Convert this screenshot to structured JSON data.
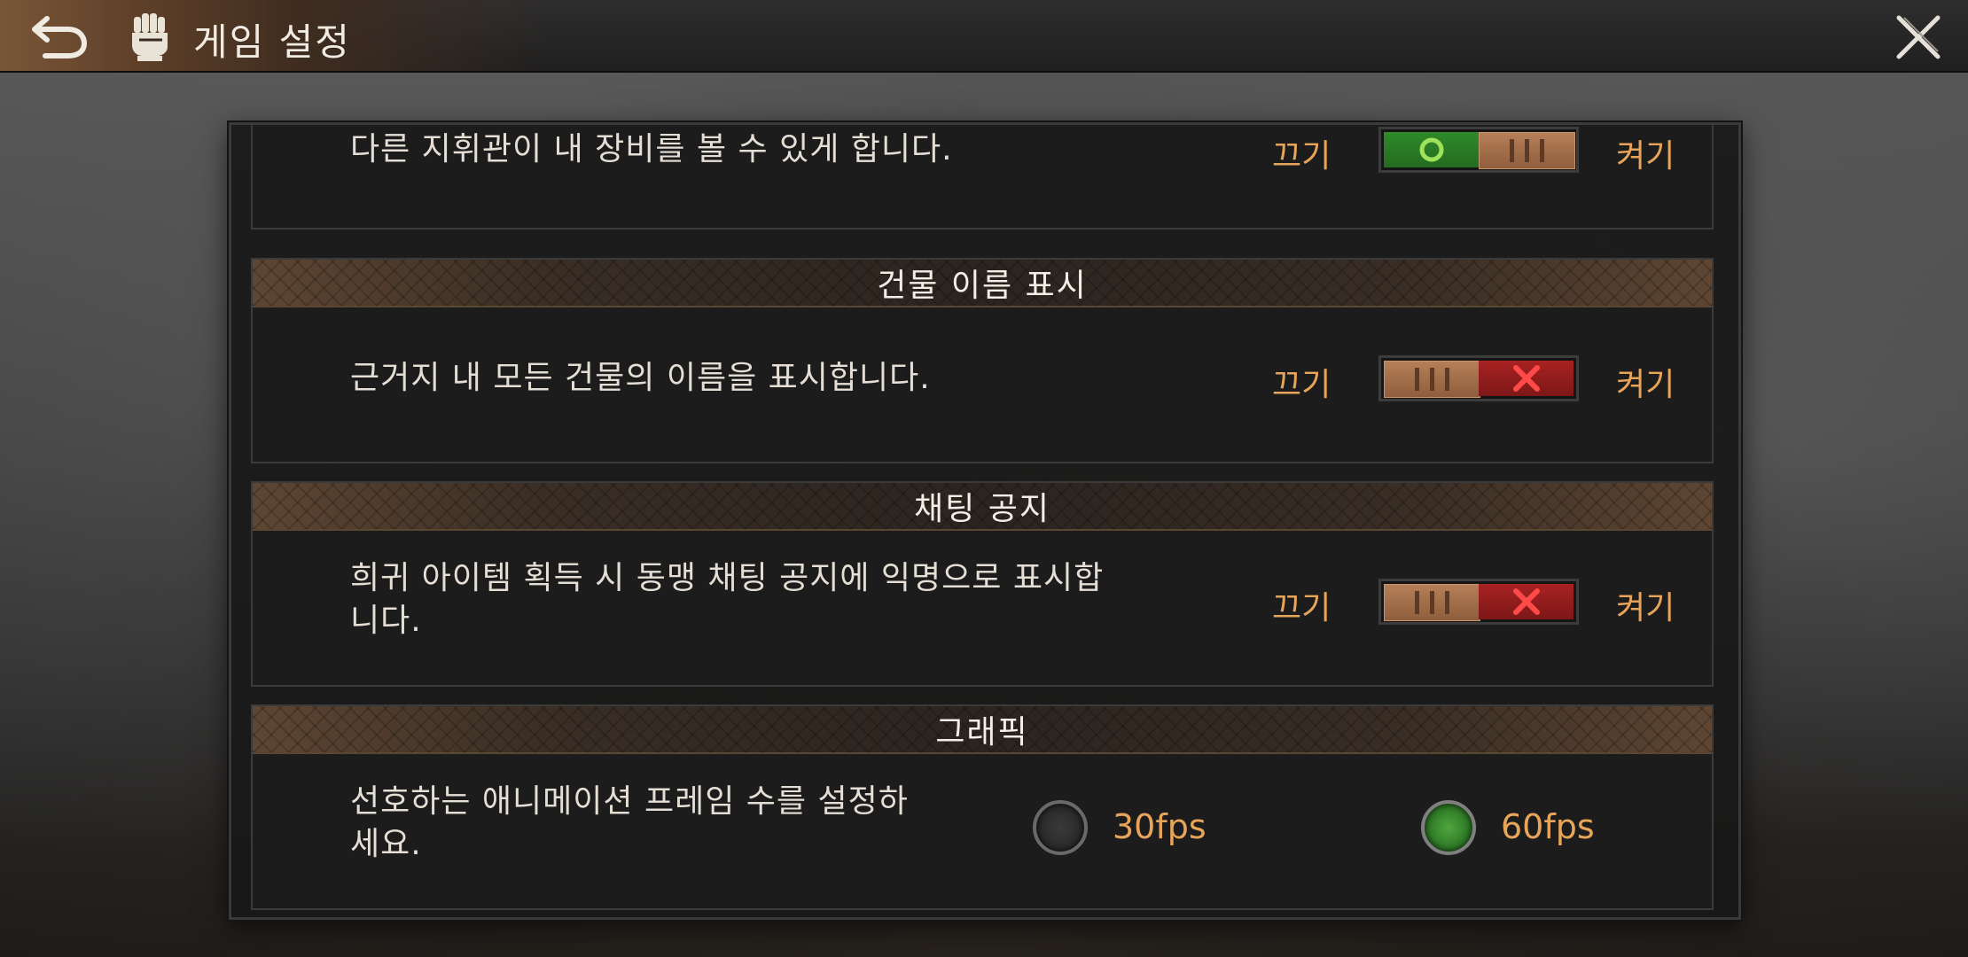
{
  "header": {
    "title": "게임 설정"
  },
  "sections": {
    "equipment": {
      "description": "다른 지휘관이 내 장비를 볼 수 있게 합니다.",
      "off_label": "끄기",
      "on_label": "켜기",
      "state": "on"
    },
    "building_names": {
      "title": "건물 이름 표시",
      "description": "근거지 내 모든 건물의 이름을 표시합니다.",
      "off_label": "끄기",
      "on_label": "켜기",
      "state": "off"
    },
    "chat_notice": {
      "title": "채팅 공지",
      "description_line1": "희귀 아이템 획득 시 동맹 채팅 공지에 익명으로 표시합",
      "description_line2": "니다.",
      "off_label": "끄기",
      "on_label": "켜기",
      "state": "off"
    },
    "graphics": {
      "title": "그래픽",
      "description_line1": "선호하는 애니메이션 프레임 수를 설정하",
      "description_line2": "세요.",
      "option_30": "30fps",
      "option_60": "60fps",
      "selected": "60fps"
    }
  },
  "colors": {
    "accent_orange": "#e8a55a",
    "toggle_on_green": "#2f8a2a",
    "toggle_off_red": "#a92222",
    "knob_copper": "#a56f4a"
  },
  "icons": {
    "back": "back-arrow-icon",
    "title": "fist-icon",
    "close": "close-icon"
  }
}
